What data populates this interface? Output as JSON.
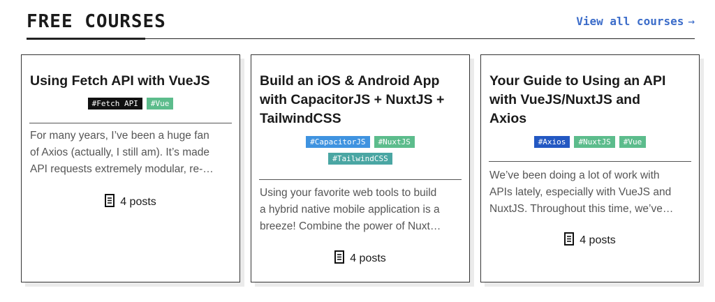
{
  "header": {
    "title": "FREE COURSES",
    "view_all": "View all courses",
    "arrow": "→"
  },
  "colors": {
    "link": "#3b6cc9",
    "tag_black": "#111111",
    "tag_green": "#5cbc8c",
    "tag_blue": "#3f93e0",
    "tag_teal": "#4aa6a3",
    "tag_darkblue": "#2358c2"
  },
  "cards": [
    {
      "title": "Using Fetch API with VueJS",
      "tags": [
        "#Fetch API",
        "#Vue"
      ],
      "excerpt_lines": [
        "For many years, I’ve been a huge fan",
        "of Axios (actually, I still am). It’s made",
        "API requests extremely modular, re-…"
      ],
      "posts_label": "4 posts",
      "posts_icon": "document-icon"
    },
    {
      "title": "Build an iOS & Android App with CapacitorJS + NuxtJS + TailwindCSS",
      "title_lines": [
        "Build an iOS & Android App",
        "with CapacitorJS + NuxtJS +",
        "TailwindCSS"
      ],
      "tags": [
        "#CapacitorJS",
        "#NuxtJS",
        "#TailwindCSS"
      ],
      "excerpt_lines": [
        "Using your favorite web tools to build",
        "a hybrid native mobile application is a",
        "breeze! Combine the power of Nuxt…"
      ],
      "posts_label": "4 posts",
      "posts_icon": "document-icon"
    },
    {
      "title": "Your Guide to Using an API with VueJS/NuxtJS and Axios",
      "title_lines": [
        "Your Guide to Using an API",
        "with VueJS/NuxtJS and",
        "Axios"
      ],
      "tags": [
        "#Axios",
        "#NuxtJS",
        "#Vue"
      ],
      "excerpt_lines": [
        "We’ve been doing a lot of work with",
        "APIs lately, especially with VueJS and",
        "NuxtJS. Throughout this time, we’ve…"
      ],
      "posts_label": "4 posts",
      "posts_icon": "document-icon"
    }
  ]
}
